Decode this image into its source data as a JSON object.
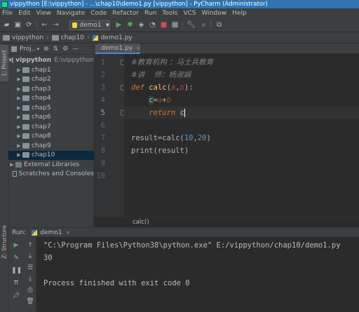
{
  "window": {
    "title": "vippython [E:\\vippython] - ...\\chap10\\demo1.py [vippython] - PyCharm (Administrator)"
  },
  "menu": [
    "File",
    "Edit",
    "View",
    "Navigate",
    "Code",
    "Refactor",
    "Run",
    "Tools",
    "VCS",
    "Window",
    "Help"
  ],
  "toolbar": {
    "run_config": "demo1"
  },
  "navbar": {
    "crumbs": [
      "vippython",
      "chap10",
      "demo1.py"
    ]
  },
  "side_tabs": {
    "project": "1: Project",
    "structure": "Z: Structure"
  },
  "project_panel": {
    "title": "Proj..",
    "root": {
      "name": "vippython",
      "path": "E:\\vippython"
    },
    "folders": [
      "chap1",
      "chap2",
      "chap3",
      "chap4",
      "chap5",
      "chap6",
      "chap7",
      "chap8",
      "chap9",
      "chap10"
    ],
    "selected": "chap10",
    "external": "External Libraries",
    "scratches": "Scratches and Consoles"
  },
  "editor": {
    "tab": "demo1.py",
    "line_numbers": [
      "1",
      "2",
      "3",
      "4",
      "5",
      "6",
      "7",
      "8",
      "9",
      "10"
    ],
    "code": {
      "l1": "#教育机构 ：马士兵教育",
      "l2": "#讲    师：杨淑娟",
      "l3_kw": "def",
      "l3_fn": "calc",
      "l3_p1": "a",
      "l3_p2": "b",
      "l4_var": "c",
      "l4_rest_a": "a",
      "l4_rest_b": "b",
      "l5_kw": "return",
      "l5_var": "c",
      "l7_a": "result=calc(",
      "l7_n1": "10",
      "l7_n2": "20",
      "l8": "print(result)"
    },
    "breadcrumb": "calc()"
  },
  "run_panel": {
    "label": "Run:",
    "tab": "demo1",
    "output": [
      "\"C:\\Program Files\\Python38\\python.exe\" E:/vippython/chap10/demo1.py",
      "30",
      "Process finished with exit code 0"
    ]
  }
}
